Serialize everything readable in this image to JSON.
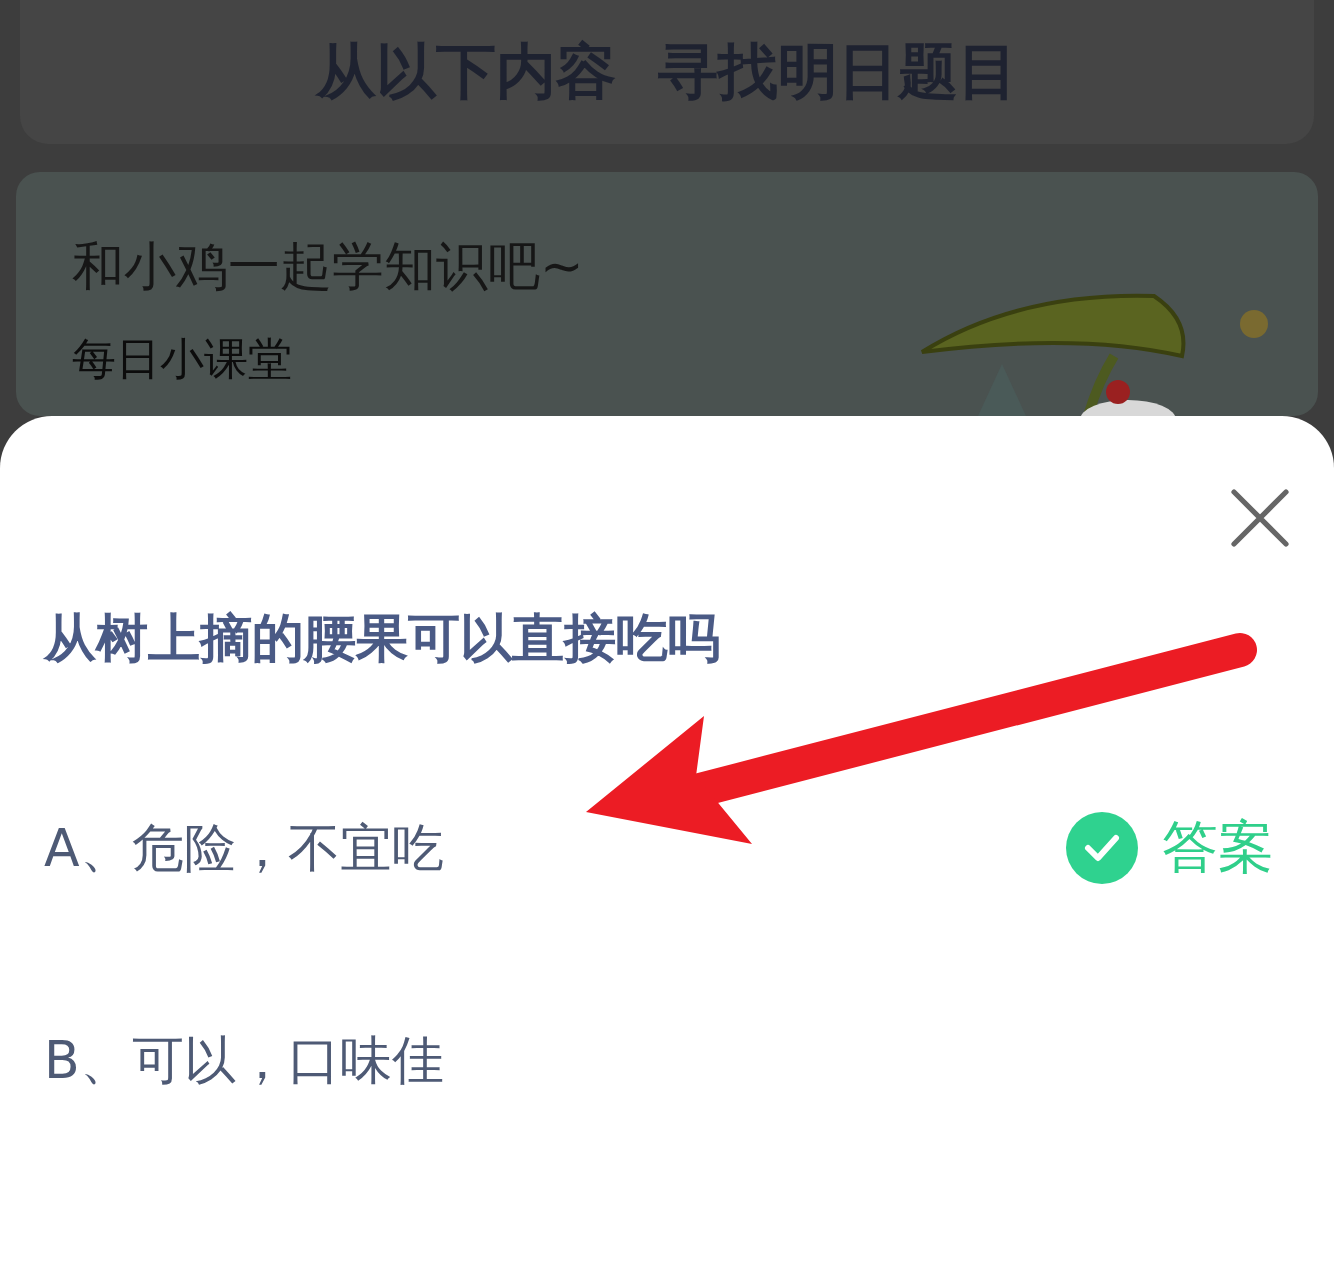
{
  "background": {
    "banner_title": "从以下内容  寻找明日题目",
    "card": {
      "title": "和小鸡一起学知识吧~",
      "subtitle": "每日小课堂"
    }
  },
  "sheet": {
    "question": "从树上摘的腰果可以直接吃吗",
    "options": [
      {
        "text": "A、危险，不宜吃",
        "correct": true,
        "answer_label": "答案"
      },
      {
        "text": "B、可以，口味佳",
        "correct": false
      }
    ]
  }
}
